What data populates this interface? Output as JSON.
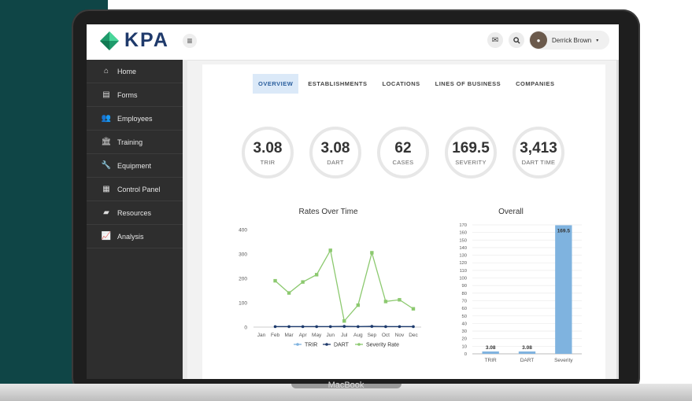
{
  "device_label": "MacBook",
  "app": {
    "logo_text": "KPA",
    "accent_green": "#3cc48a",
    "accent_blue": "#2b5f9e",
    "menu_icon": "hamburger-icon"
  },
  "header": {
    "mail_icon": "mail-icon",
    "search_icon": "search-icon",
    "user_name": "Derrick Brown",
    "user_caret": "▾"
  },
  "sidebar": {
    "items": [
      {
        "label": "Home",
        "icon": "home-icon"
      },
      {
        "label": "Forms",
        "icon": "forms-icon"
      },
      {
        "label": "Employees",
        "icon": "employees-icon"
      },
      {
        "label": "Training",
        "icon": "training-icon"
      },
      {
        "label": "Equipment",
        "icon": "wrench-icon"
      },
      {
        "label": "Control Panel",
        "icon": "grid-icon"
      },
      {
        "label": "Resources",
        "icon": "book-icon"
      },
      {
        "label": "Analysis",
        "icon": "chart-icon"
      }
    ]
  },
  "tabs": [
    {
      "label": "OVERVIEW",
      "active": true
    },
    {
      "label": "ESTABLISHMENTS",
      "active": false
    },
    {
      "label": "LOCATIONS",
      "active": false
    },
    {
      "label": "LINES OF BUSINESS",
      "active": false
    },
    {
      "label": "COMPANIES",
      "active": false
    }
  ],
  "metrics": [
    {
      "value": "3.08",
      "label": "TRIR"
    },
    {
      "value": "3.08",
      "label": "DART"
    },
    {
      "value": "62",
      "label": "CASES"
    },
    {
      "value": "169.5",
      "label": "SEVERITY"
    },
    {
      "value": "3,413",
      "label": "DART TIME"
    }
  ],
  "chart_data": [
    {
      "type": "line",
      "title": "Rates Over Time",
      "x": [
        "Jan",
        "Feb",
        "Mar",
        "Apr",
        "May",
        "Jun",
        "Jul",
        "Aug",
        "Sep",
        "Oct",
        "Nov",
        "Dec"
      ],
      "ylim": [
        0,
        400
      ],
      "yticks": [
        0,
        100,
        200,
        300,
        400
      ],
      "grid": false,
      "legend": "bottom",
      "series": [
        {
          "name": "TRIR",
          "color": "#7fb3df",
          "values": [
            null,
            2,
            2,
            2,
            2,
            2,
            3,
            2,
            3,
            2,
            2,
            2
          ]
        },
        {
          "name": "DART",
          "color": "#1f3a6b",
          "values": [
            null,
            2,
            2,
            2,
            2,
            2,
            3,
            2,
            3,
            2,
            2,
            2
          ]
        },
        {
          "name": "Severity Rate",
          "color": "#8cc96f",
          "values": [
            null,
            190,
            140,
            185,
            215,
            315,
            25,
            90,
            305,
            105,
            112,
            75
          ]
        }
      ]
    },
    {
      "type": "bar",
      "title": "Overall",
      "categories": [
        "TRIR",
        "DART",
        "Severity"
      ],
      "values": [
        3.08,
        3.08,
        169.5
      ],
      "data_labels": [
        "3.08",
        "3.08",
        "169.5"
      ],
      "ylim": [
        0,
        170
      ],
      "ytick_step": 10,
      "grid": true,
      "color": "#7fb3df"
    }
  ]
}
